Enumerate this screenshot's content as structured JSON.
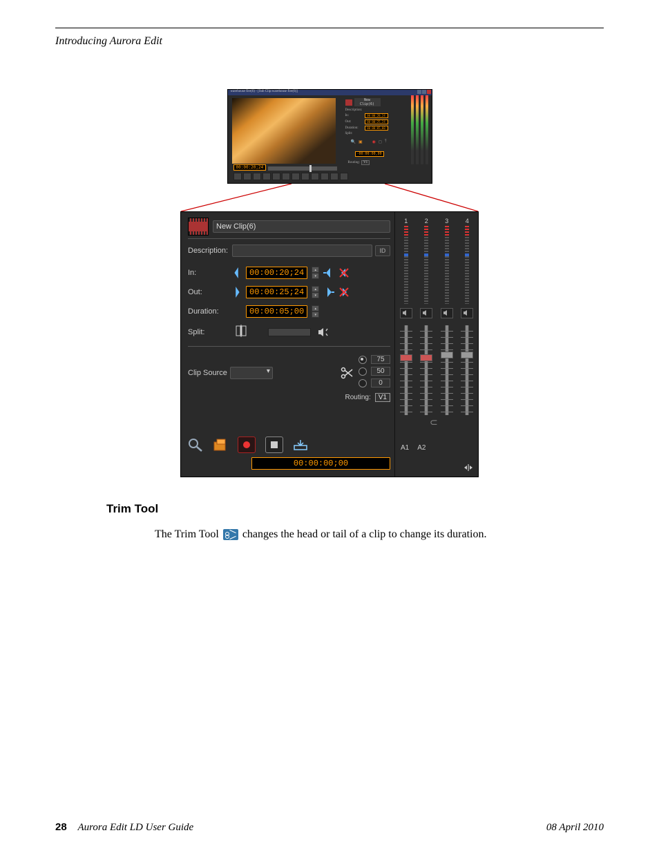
{
  "chapter_title": "Introducing Aurora Edit",
  "small_window": {
    "title": "warehouse fire(6) - [Sub Clip:warehouse fire(6)]",
    "timecode": "00:00:20;24",
    "clip_name_label": "New Clip(6)",
    "description_label": "Description:",
    "in_label": "In:",
    "in_value": "00:00:20,24",
    "out_label": "Out:",
    "out_value": "00:00:25,24",
    "duration_label": "Duration:",
    "duration_value": "00:00:05,00",
    "split_label": "Split:",
    "routing_label": "Routing:",
    "routing_value": "V1",
    "bottom_tc": "-00:00:00,00"
  },
  "detail": {
    "clip_name": "New Clip(6)",
    "description_label": "Description:",
    "id_label": "ID",
    "in_label": "In:",
    "in_value": "00:00:20;24",
    "out_label": "Out:",
    "out_value": "00:00:25;24",
    "duration_label": "Duration:",
    "duration_value": "00:00:05;00",
    "split_label": "Split:",
    "clip_source_label": "Clip Source",
    "speed_opts": [
      "75",
      "50",
      "0"
    ],
    "routing_label": "Routing:",
    "routing_value": "V1",
    "bottom_tc": "00:00:00;00",
    "meter_nums": [
      "1",
      "2",
      "3",
      "4"
    ],
    "ch_labels": [
      "A1",
      "A2"
    ]
  },
  "section_heading": "Trim Tool",
  "body_text_before": "The Trim Tool ",
  "body_text_after": " changes the head or tail of a clip to change its duration.",
  "footer": {
    "page": "28",
    "book": "Aurora Edit LD User Guide",
    "date": "08 April 2010"
  }
}
